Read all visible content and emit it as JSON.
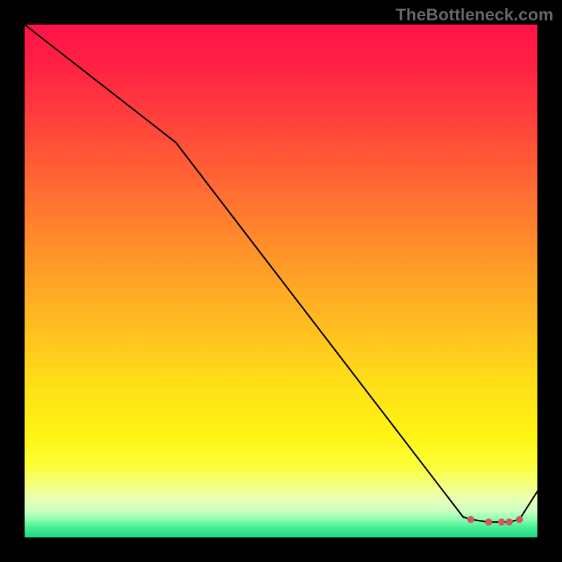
{
  "watermark": "TheBottleneck.com",
  "colors": {
    "background_border": "#000000",
    "line_stroke": "#000000",
    "marker_fill": "#d4555f"
  },
  "gradient_stops": [
    {
      "offset": 0.0,
      "color": "#ff1348"
    },
    {
      "offset": 0.08,
      "color": "#ff2143"
    },
    {
      "offset": 0.18,
      "color": "#ff3f3c"
    },
    {
      "offset": 0.32,
      "color": "#ff6b33"
    },
    {
      "offset": 0.45,
      "color": "#ff9529"
    },
    {
      "offset": 0.58,
      "color": "#ffbb20"
    },
    {
      "offset": 0.7,
      "color": "#ffdf18"
    },
    {
      "offset": 0.8,
      "color": "#fff414"
    },
    {
      "offset": 0.86,
      "color": "#fcff38"
    },
    {
      "offset": 0.905,
      "color": "#f1ff8e"
    },
    {
      "offset": 0.93,
      "color": "#e4ffb9"
    },
    {
      "offset": 0.95,
      "color": "#c7ffc0"
    },
    {
      "offset": 0.965,
      "color": "#8bffae"
    },
    {
      "offset": 0.98,
      "color": "#4aee96"
    },
    {
      "offset": 1.0,
      "color": "#1fd983"
    }
  ],
  "chart_data": {
    "type": "line",
    "title": "",
    "xlabel": "",
    "ylabel": "",
    "xlim": [
      0,
      1
    ],
    "ylim": [
      0,
      1
    ],
    "x": [
      0.0,
      0.295,
      0.855,
      0.87,
      0.905,
      0.93,
      0.945,
      0.965,
      1.0
    ],
    "values": [
      1.0,
      0.77,
      0.04,
      0.035,
      0.03,
      0.03,
      0.03,
      0.035,
      0.09
    ],
    "marker_indices": [
      3,
      4,
      5,
      6,
      7
    ]
  }
}
